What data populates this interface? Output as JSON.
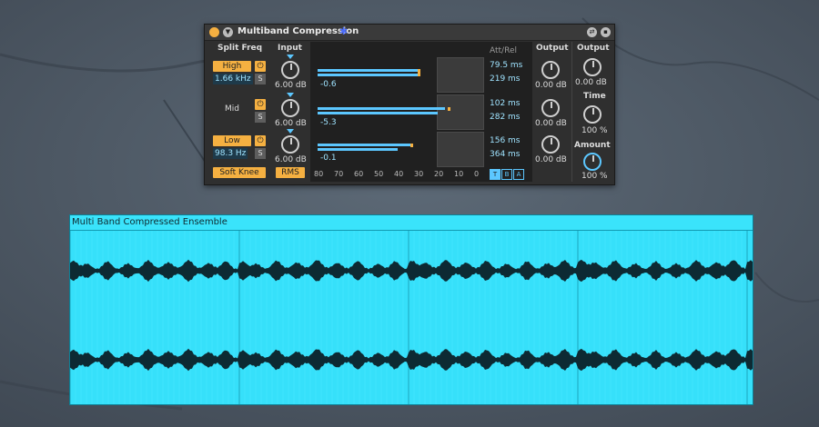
{
  "device": {
    "title": "Multiband Compression",
    "split_freq_label": "Split Freq",
    "input_label": "Input",
    "att_rel_label": "Att/Rel",
    "output_label": "Output",
    "output2_label": "Output",
    "time_label": "Time",
    "amount_label": "Amount",
    "bands": [
      {
        "name": "High",
        "freq": "1.66 kHz",
        "input": "6.00 dB",
        "meter_value": "-0.6",
        "attack": "79.5 ms",
        "release": "219 ms",
        "output": "0.00 dB"
      },
      {
        "name": "Mid",
        "freq": "",
        "input": "6.00 dB",
        "meter_value": "-5.3",
        "attack": "102 ms",
        "release": "282 ms",
        "output": "0.00 dB"
      },
      {
        "name": "Low",
        "freq": "98.3 Hz",
        "input": "6.00 dB",
        "meter_value": "-0.1",
        "attack": "156 ms",
        "release": "364 ms",
        "output": "0.00 dB"
      }
    ],
    "power_glyph": "⏻",
    "solo_label": "S",
    "soft_knee_label": "Soft Knee",
    "rms_label": "RMS",
    "axis": [
      "80",
      "70",
      "60",
      "50",
      "40",
      "30",
      "20",
      "10",
      "0"
    ],
    "mode_buttons": [
      "T",
      "B",
      "A"
    ],
    "output_value": "0.00 dB",
    "time_value": "100 %",
    "amount_value": "100 %",
    "accent": "#5cc7ff",
    "button_color": "#f5b041"
  },
  "clip": {
    "title": "Multi Band Compressed Ensemble",
    "color": "#36e0fa"
  }
}
